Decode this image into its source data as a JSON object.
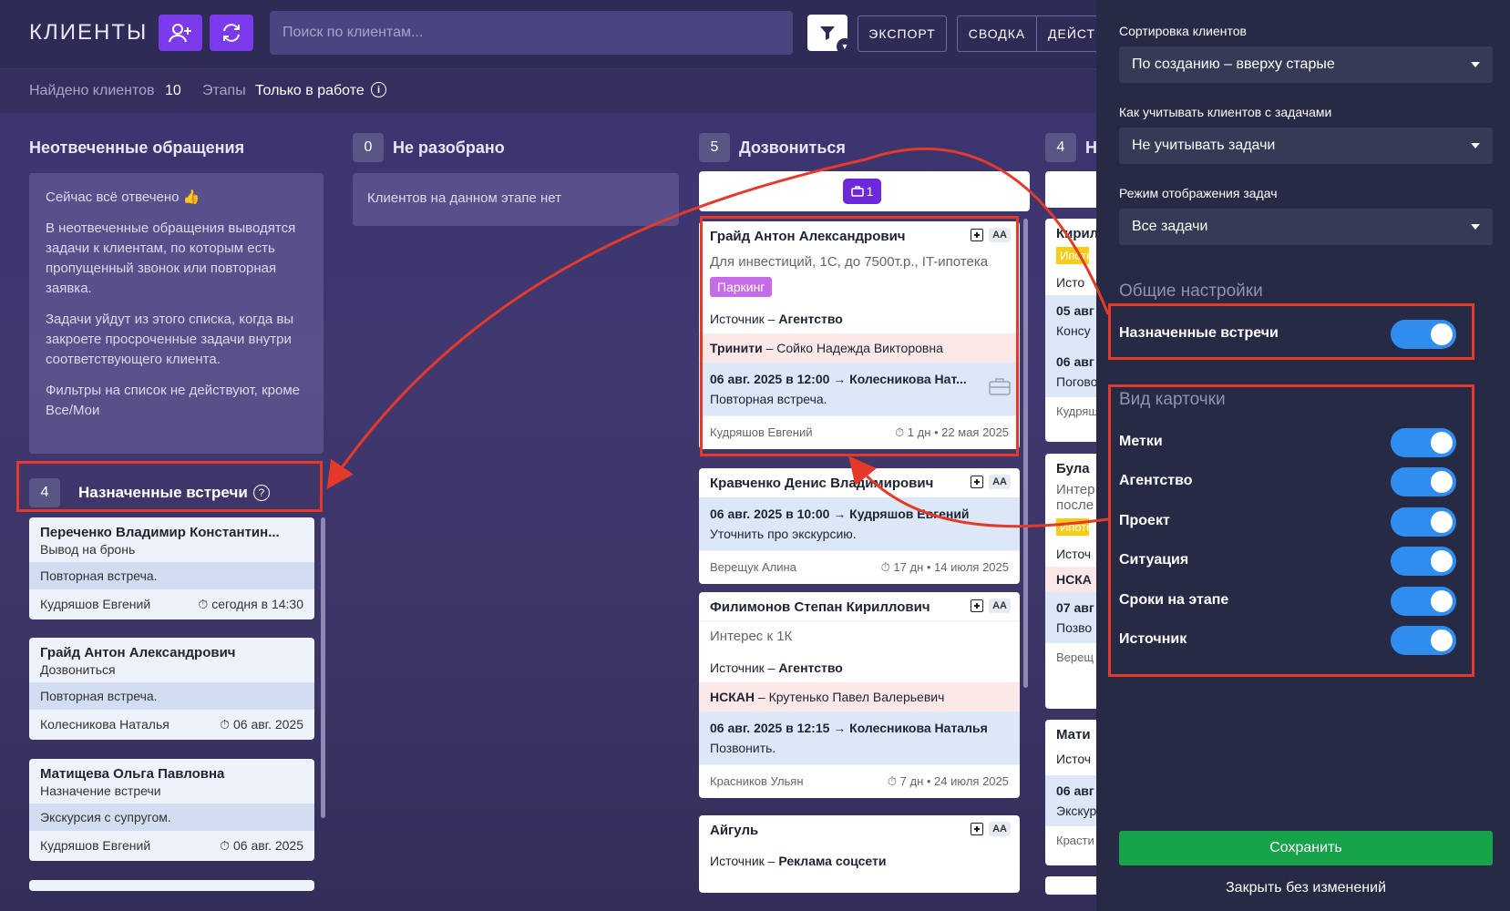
{
  "header": {
    "title": "КЛИЕНТЫ",
    "search_placeholder": "Поиск по клиентам...",
    "buttons": {
      "export": "ЭКСПОРТ",
      "summary": "СВОДКА",
      "actions": "ДЕЙСТ"
    }
  },
  "subbar": {
    "found_label": "Найдено клиентов",
    "found_count": "10",
    "stages_label": "Этапы",
    "stages_value": "Только в работе"
  },
  "columns": {
    "unanswered": {
      "title": "Неотвеченные обращения",
      "info": [
        "Сейчас всё отвечено 👍",
        "В неотвеченные обращения выводятся задачи к клиентам, по которым есть пропущенный звонок или повторная заявка.",
        "Задачи уйдут из этого списка, когда вы закроете просроченные задачи внутри соответствующего клиента.",
        "Фильтры на список не действуют, кроме Все/Мои"
      ]
    },
    "meetings": {
      "count": "4",
      "title": "Назначенные встречи",
      "cards": [
        {
          "name": "Переченко Владимир Константин...",
          "stage": "Вывод на бронь",
          "note": "Повторная встреча.",
          "manager": "Кудряшов Евгений",
          "time": "сегодня в 14:30"
        },
        {
          "name": "Грайд Антон Александрович",
          "stage": "Дозвониться",
          "note": "Повторная встреча.",
          "manager": "Колесникова Наталья",
          "time": "06 авг. 2025"
        },
        {
          "name": "Матищева Ольга Павловна",
          "stage": "Назначение встречи",
          "note": "Экскурсия с супругом.",
          "manager": "Кудряшов Евгений",
          "time": "06 авг. 2025"
        }
      ]
    },
    "unsorted": {
      "count": "0",
      "title": "Не разобрано",
      "empty": "Клиентов на данном этапе нет"
    },
    "call": {
      "count": "5",
      "title": "Дозвониться",
      "task_count": "1",
      "aa": "AA",
      "cards": [
        {
          "name": "Грайд Антон Александрович",
          "desc": "Для инвестиций, 1С, до 7500т.р., IT-ипотека",
          "tag": "Паркинг",
          "source_label": "Источник –",
          "source": "Агентство",
          "project": "Тринити",
          "project_contact": "– Сойко Надежда Викторовна",
          "task_line": "06 авг. 2025 в 12:00 → Колесникова Нат...",
          "task_note": "Повторная встреча.",
          "manager": "Кудряшов Евгений",
          "time": "1 дн • 22 мая 2025"
        },
        {
          "name": "Кравченко Денис Владимирович",
          "task_line": "06 авг. 2025 в 10:00 → Кудряшов Евгений",
          "task_note": "Уточнить про экскурсию.",
          "manager": "Верещук Алина",
          "time": "17 дн • 14 июля 2025"
        },
        {
          "name": "Филимонов Степан Кириллович",
          "desc": "Интерес к 1К",
          "source_label": "Источник –",
          "source": "Агентство",
          "project": "НСКАН",
          "project_contact": "– Крутенько Павел Валерьевич",
          "task_line": "06 авг. 2025 в 12:15 → Колесникова Наталья",
          "task_note": "Позвонить.",
          "manager": "Красников Ульян",
          "time": "7 дн • 24 июля 2025"
        },
        {
          "name": "Айгуль",
          "source_label": "Источник –",
          "source": "Реклама соцсети"
        }
      ]
    },
    "fourth": {
      "count": "4",
      "title": "Н",
      "fragments": [
        "Кирил",
        "Ипоте",
        "Исто",
        "05 авг",
        "Консу",
        "06 авг",
        "Погово",
        "Кудряш",
        "Була",
        "Интер",
        "после",
        "Ипоте",
        "Источ",
        "НСКА",
        "07 авг",
        "Позво",
        "Верещ",
        "Мати",
        "Источ",
        "06 авг",
        "Экскур",
        "Красти"
      ]
    }
  },
  "settings": {
    "sort_label": "Сортировка клиентов",
    "sort_value": "По созданию – вверху старые",
    "tasks_label": "Как учитывать клиентов с задачами",
    "tasks_value": "Не учитывать задачи",
    "mode_label": "Режим отображения задач",
    "mode_value": "Все задачи",
    "general_title": "Общие настройки",
    "meetings_toggle": "Назначенные встречи",
    "card_view_title": "Вид карточки",
    "toggles": [
      "Метки",
      "Агентство",
      "Проект",
      "Ситуация",
      "Сроки на этапе",
      "Источник"
    ],
    "save": "Сохранить",
    "close": "Закрыть без изменений"
  },
  "colors": {
    "accent": "#7c3aed",
    "toggle_on": "#2f8df0",
    "save": "#16a34a",
    "annotation": "#e53a2a"
  }
}
